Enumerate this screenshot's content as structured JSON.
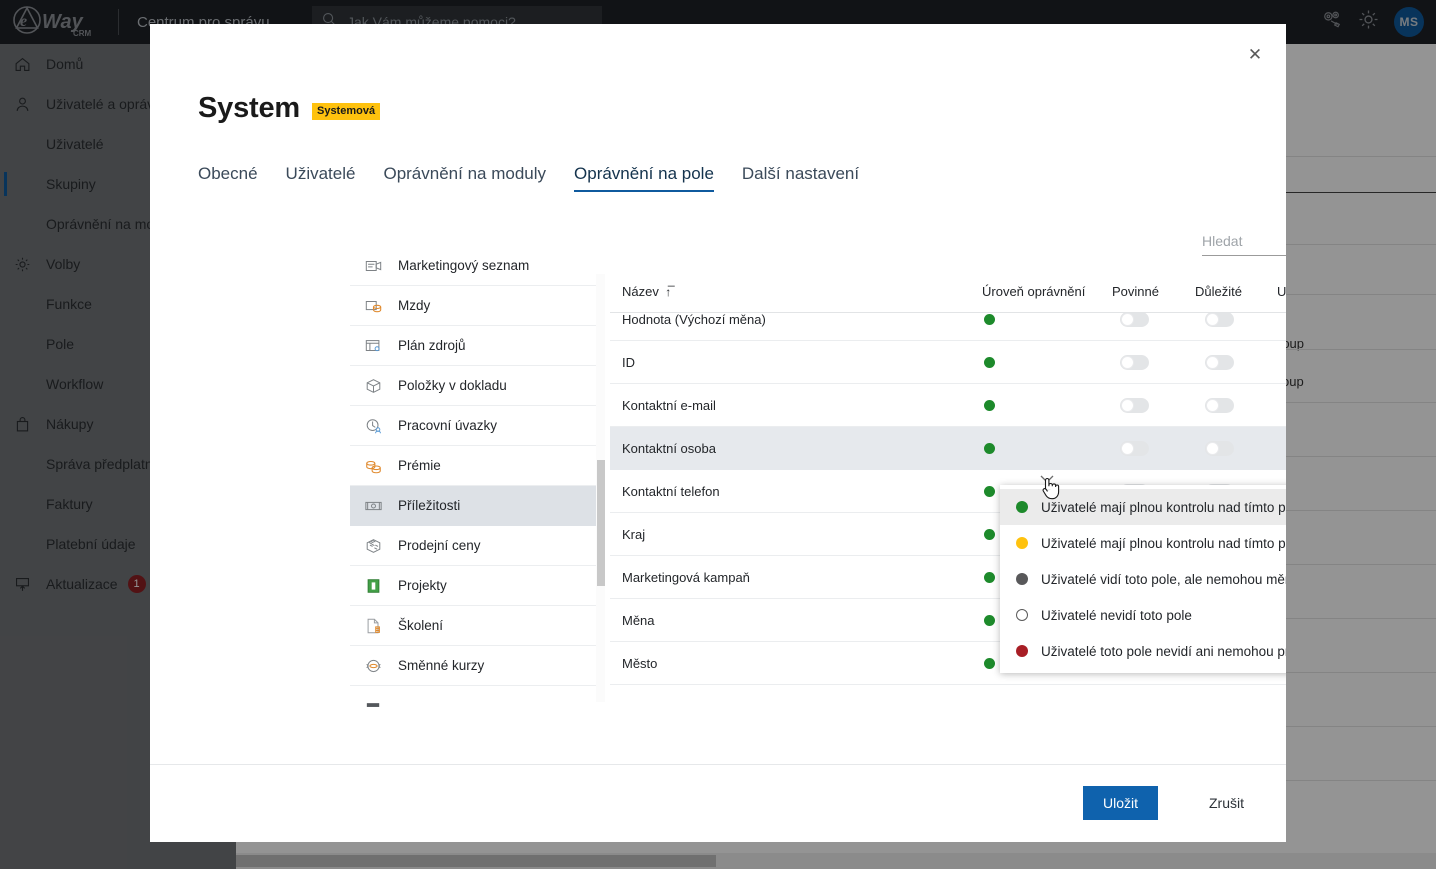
{
  "topbar": {
    "brand": "eWay CRM",
    "app_title": "Centrum pro správu",
    "search_placeholder": "Jak Vám můžeme pomoci?",
    "icons": [
      "gears-admin-icon",
      "gear-icon"
    ],
    "avatar_initials": "MS"
  },
  "sidebar": {
    "items": [
      {
        "label": "Domů",
        "icon": "home-icon",
        "level": "top",
        "active": false,
        "badge": null
      },
      {
        "label": "Uživatelé a oprávnění",
        "icon": "user-icon",
        "level": "top",
        "active": false,
        "badge": null
      },
      {
        "label": "Uživatelé",
        "icon": null,
        "level": "sub",
        "active": false,
        "badge": null
      },
      {
        "label": "Skupiny",
        "icon": null,
        "level": "sub",
        "active": true,
        "badge": null
      },
      {
        "label": "Oprávnění na moduly",
        "icon": null,
        "level": "sub",
        "active": false,
        "badge": null
      },
      {
        "label": "Volby",
        "icon": "gear-icon",
        "level": "top",
        "active": false,
        "badge": null
      },
      {
        "label": "Funkce",
        "icon": null,
        "level": "sub",
        "active": false,
        "badge": null
      },
      {
        "label": "Pole",
        "icon": null,
        "level": "sub",
        "active": false,
        "badge": null
      },
      {
        "label": "Workflow",
        "icon": null,
        "level": "sub",
        "active": false,
        "badge": null
      },
      {
        "label": "Nákupy",
        "icon": "bag-icon",
        "level": "top",
        "active": false,
        "badge": null
      },
      {
        "label": "Správa předplatného",
        "icon": null,
        "level": "sub",
        "active": false,
        "badge": null
      },
      {
        "label": "Faktury",
        "icon": null,
        "level": "sub",
        "active": false,
        "badge": null
      },
      {
        "label": "Platební údaje",
        "icon": null,
        "level": "sub",
        "active": false,
        "badge": null
      },
      {
        "label": "Aktualizace",
        "icon": "update-icon",
        "level": "top",
        "active": false,
        "badge": "1"
      }
    ]
  },
  "background": {
    "fragment_1": "roup",
    "fragment_2": "oup"
  },
  "modal": {
    "title": "System",
    "title_badge": "Systemová",
    "close_label": "✕",
    "tabs": [
      {
        "label": "Obecné",
        "active": false
      },
      {
        "label": "Uživatelé",
        "active": false
      },
      {
        "label": "Oprávnění na moduly",
        "active": false
      },
      {
        "label": "Oprávnění na pole",
        "active": true
      },
      {
        "label": "Další nastavení",
        "active": false
      }
    ],
    "search": {
      "value": "",
      "placeholder": "Hledat"
    },
    "modules": [
      {
        "label": "Marketingový seznam",
        "icon": "marketing-list-icon",
        "selected": false
      },
      {
        "label": "Mzdy",
        "icon": "wages-icon",
        "selected": false
      },
      {
        "label": "Plán zdrojů",
        "icon": "resource-plan-icon",
        "selected": false
      },
      {
        "label": "Položky v dokladu",
        "icon": "document-items-icon",
        "selected": false
      },
      {
        "label": "Pracovní úvazky",
        "icon": "work-commitments-icon",
        "selected": false
      },
      {
        "label": "Prémie",
        "icon": "bonus-icon",
        "selected": false
      },
      {
        "label": "Příležitosti",
        "icon": "opportunity-icon",
        "selected": true
      },
      {
        "label": "Prodejní ceny",
        "icon": "sales-prices-icon",
        "selected": false
      },
      {
        "label": "Projekty",
        "icon": "projects-icon",
        "selected": false
      },
      {
        "label": "Školení",
        "icon": "training-icon",
        "selected": false
      },
      {
        "label": "Směnné kurzy",
        "icon": "exchange-rates-icon",
        "selected": false
      },
      {
        "label": "",
        "icon": "partial-icon",
        "selected": false
      }
    ],
    "table": {
      "columns": [
        "Název",
        "Úroveň oprávnění",
        "Povinné",
        "Důležité",
        "Unikátní"
      ],
      "sort_column": "Název",
      "sort_direction": "asc",
      "rows": [
        {
          "name": "Hodnota (Výchozí měna)",
          "level_color": "#1d8a2b",
          "povinne": false,
          "dulezite": false,
          "unikatni": false,
          "highlighted": false
        },
        {
          "name": "ID",
          "level_color": "#1d8a2b",
          "povinne": false,
          "dulezite": false,
          "unikatni": false,
          "highlighted": false
        },
        {
          "name": "Kontaktní e-mail",
          "level_color": "#1d8a2b",
          "povinne": false,
          "dulezite": false,
          "unikatni": false,
          "highlighted": false
        },
        {
          "name": "Kontaktní osoba",
          "level_color": "#1d8a2b",
          "povinne": false,
          "dulezite": false,
          "unikatni": false,
          "highlighted": true
        },
        {
          "name": "Kontaktní telefon",
          "level_color": "#1d8a2b",
          "povinne": false,
          "dulezite": false,
          "unikatni": false,
          "highlighted": false
        },
        {
          "name": "Kraj",
          "level_color": "#1d8a2b",
          "povinne": false,
          "dulezite": false,
          "unikatni": false,
          "highlighted": false
        },
        {
          "name": "Marketingová kampaň",
          "level_color": "#1d8a2b",
          "povinne": false,
          "dulezite": false,
          "unikatni": false,
          "highlighted": false
        },
        {
          "name": "Měna",
          "level_color": "#1d8a2b",
          "povinne": false,
          "dulezite": false,
          "unikatni": false,
          "highlighted": false
        },
        {
          "name": "Město",
          "level_color": "#1d8a2b",
          "povinne": false,
          "dulezite": false,
          "unikatni": false,
          "highlighted": false
        }
      ]
    },
    "permission_dropdown": {
      "open": true,
      "options": [
        {
          "label": "Uživatelé mají plnou kontrolu nad tímto polem",
          "color": "#1d8a2b",
          "hollow": false,
          "hovered": true
        },
        {
          "label": "Uživatelé mají plnou kontrolu nad tímto polem u svých položek",
          "color": "#ffc20e",
          "hollow": false,
          "hovered": false
        },
        {
          "label": "Uživatelé vidí toto pole, ale nemohou měnit jeho hodnotu",
          "color": "#58585a",
          "hollow": false,
          "hovered": false
        },
        {
          "label": "Uživatelé nevidí toto pole",
          "color": "#ffffff",
          "hollow": true,
          "hovered": false
        },
        {
          "label": "Uživatelé toto pole nevidí ani nemohou pracovat s jeho hodnotami",
          "color": "#a81e25",
          "hollow": false,
          "hovered": false
        }
      ]
    },
    "footer": {
      "save_label": "Uložit",
      "cancel_label": "Zrušit"
    }
  },
  "colors": {
    "accent": "#0f5a9e",
    "save_button": "#0f62ad",
    "badge_yellow": "#ffc20e",
    "topbar_bg": "#1e2226",
    "sidebar_bg": "#737679"
  }
}
